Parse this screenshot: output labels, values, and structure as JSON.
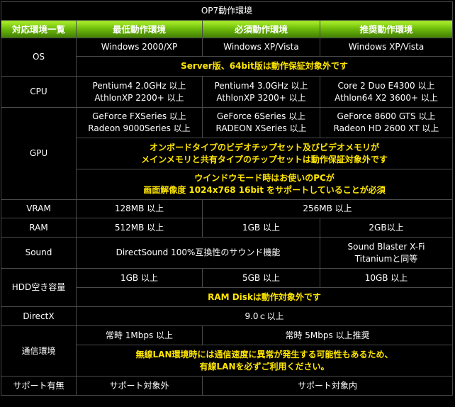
{
  "title": "OP7動作環境",
  "headers": [
    "対応環境一覧",
    "最低動作環境",
    "必須動作環境",
    "推奨動作環境"
  ],
  "os": {
    "label": "OS",
    "min": "Windows 2000/XP",
    "req": "Windows XP/Vista",
    "rec": "Windows XP/Vista",
    "note": "Server版、64bit版は動作保証対象外です"
  },
  "cpu": {
    "label": "CPU",
    "min": "Pentium4 2.0GHz 以上\nAthlonXP 2200+ 以上",
    "req": "Pentium4 3.0GHz 以上\nAthlonXP 3200+ 以上",
    "rec": "Core 2 Duo E4300 以上\nAthlon64 X2 3600+ 以上"
  },
  "gpu": {
    "label": "GPU",
    "min": "GeForce FXSeries 以上\nRadeon 9000Series 以上",
    "req": "GeForce 6Series 以上\nRADEON XSeries 以上",
    "rec": "GeForce 8600 GTS 以上\nRadeon HD 2600 XT 以上",
    "note1": "オンボードタイプのビデオチップセット及びビデオメモリが\nメインメモリと共有タイプのチップセットは動作保証対象外です",
    "note2": "ウインドウモード時はお使いのPCが\n画面解像度 1024x768 16bit をサポートしていることが必須"
  },
  "vram": {
    "label": "VRAM",
    "min": "128MB 以上",
    "req_rec": "256MB 以上"
  },
  "ram": {
    "label": "RAM",
    "min": "512MB 以上",
    "req": "1GB 以上",
    "rec": "2GB以上"
  },
  "sound": {
    "label": "Sound",
    "min_req": "DirectSound 100%互換性のサウンド機能",
    "rec": "Sound Blaster X-Fi\nTitaniumと同等"
  },
  "hdd": {
    "label": "HDD空き容量",
    "min": "1GB 以上",
    "req": "5GB 以上",
    "rec": "10GB 以上",
    "note": "RAM Diskは動作対象外です"
  },
  "directx": {
    "label": "DirectX",
    "value": "9.0ｃ以上"
  },
  "network": {
    "label": "通信環境",
    "min": "常時 1Mbps 以上",
    "req_rec": "常時 5Mbps 以上推奨",
    "note": "無線LAN環境時には通信速度に異常が発生する可能性もあるため、\n有線LANを必ずご利用ください。"
  },
  "support": {
    "label": "サポート有無",
    "min": "サポート対象外",
    "req_rec": "サポート対象内"
  },
  "colors": {
    "background": "#000000",
    "note_yellow": "#ffe600",
    "header_green": "#6fbc0c",
    "border": "#4a4a4a"
  }
}
